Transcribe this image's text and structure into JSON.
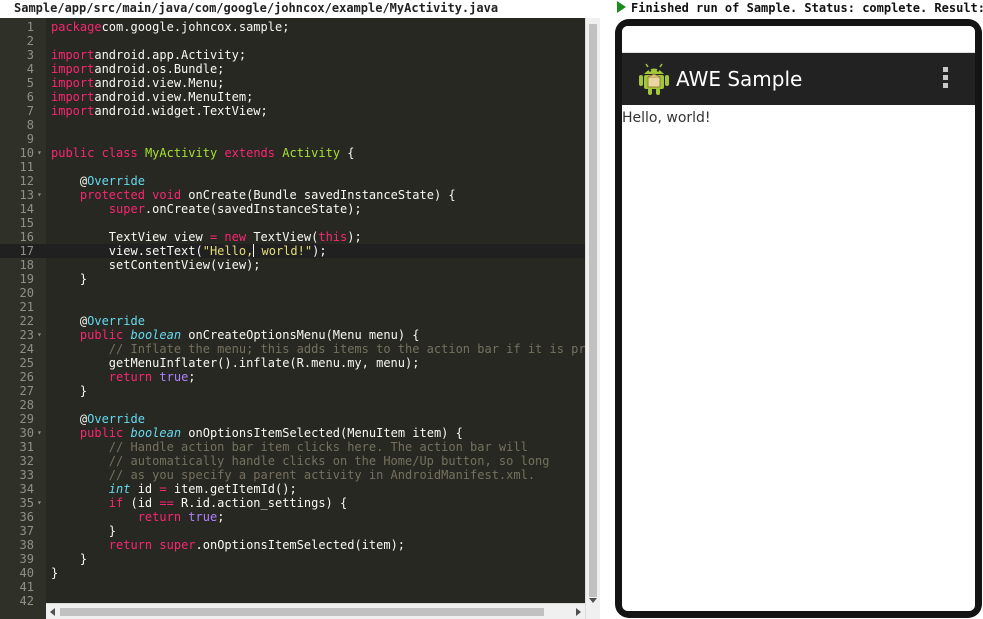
{
  "file_path": "Sample/app/src/main/java/com/google/johncox/example/MyActivity.java",
  "run_status": "Finished run of Sample. Status: complete. Result:",
  "editor": {
    "active_line": 17,
    "foldable_lines": [
      10,
      13,
      23,
      30,
      35
    ],
    "lines": [
      [
        [
          "kw",
          "package"
        ],
        [
          "",
          "com.google.johncox.sample;"
        ]
      ],
      [],
      [
        [
          "kw",
          "import"
        ],
        [
          "",
          "android.app.Activity;"
        ]
      ],
      [
        [
          "kw",
          "import"
        ],
        [
          "",
          "android.os.Bundle;"
        ]
      ],
      [
        [
          "kw",
          "import"
        ],
        [
          "",
          "android.view.Menu;"
        ]
      ],
      [
        [
          "kw",
          "import"
        ],
        [
          "",
          "android.view.MenuItem;"
        ]
      ],
      [
        [
          "kw",
          "import"
        ],
        [
          "",
          "android.widget.TextView;"
        ]
      ],
      [],
      [],
      [
        [
          "kw",
          "public"
        ],
        [
          "",
          ""
        ],
        [
          "kw",
          "class"
        ],
        [
          "",
          ""
        ],
        [
          "cl",
          "MyActivity"
        ],
        [
          "",
          ""
        ],
        [
          "kw",
          "extends"
        ],
        [
          "",
          ""
        ],
        [
          "cl",
          "Activity"
        ],
        [
          "",
          " {"
        ]
      ],
      [],
      [
        [
          "",
          "    @"
        ],
        [
          "an",
          "Override"
        ]
      ],
      [
        [
          "",
          "    "
        ],
        [
          "kw",
          "protected"
        ],
        [
          "",
          ""
        ],
        [
          "kw",
          "void"
        ],
        [
          "",
          " onCreate(Bundle savedInstanceState) {"
        ]
      ],
      [
        [
          "",
          "        "
        ],
        [
          "kw",
          "super"
        ],
        [
          "",
          ".onCreate(savedInstanceState);"
        ]
      ],
      [],
      [
        [
          "",
          "        TextView view "
        ],
        [
          "kw",
          "="
        ],
        [
          "",
          ""
        ],
        [
          "kw",
          "new"
        ],
        [
          "",
          " TextView("
        ],
        [
          "kw",
          "this"
        ],
        [
          "",
          ");"
        ]
      ],
      [
        [
          "",
          "        view.setText("
        ],
        [
          "str",
          "\"Hello,"
        ],
        [
          "caret",
          ""
        ],
        [
          "str",
          " world!\""
        ],
        [
          "",
          ");"
        ]
      ],
      [
        [
          "",
          "        setContentView(view);"
        ]
      ],
      [
        [
          "",
          "    }"
        ]
      ],
      [],
      [],
      [
        [
          "",
          "    @"
        ],
        [
          "an",
          "Override"
        ]
      ],
      [
        [
          "",
          "    "
        ],
        [
          "kw",
          "public"
        ],
        [
          "",
          ""
        ],
        [
          "st",
          "boolean"
        ],
        [
          "",
          " onCreateOptionsMenu(Menu menu) {"
        ]
      ],
      [
        [
          "",
          "        "
        ],
        [
          "cm",
          "// Inflate the menu; this adds items to the action bar if it is present."
        ]
      ],
      [
        [
          "",
          "        getMenuInflater().inflate(R.menu.my, menu);"
        ]
      ],
      [
        [
          "",
          "        "
        ],
        [
          "kw",
          "return"
        ],
        [
          "",
          ""
        ],
        [
          "lit",
          "true"
        ],
        [
          "",
          ";"
        ]
      ],
      [
        [
          "",
          "    }"
        ]
      ],
      [],
      [
        [
          "",
          "    @"
        ],
        [
          "an",
          "Override"
        ]
      ],
      [
        [
          "",
          "    "
        ],
        [
          "kw",
          "public"
        ],
        [
          "",
          ""
        ],
        [
          "st",
          "boolean"
        ],
        [
          "",
          " onOptionsItemSelected(MenuItem item) {"
        ]
      ],
      [
        [
          "",
          "        "
        ],
        [
          "cm",
          "// Handle action bar item clicks here. The action bar will"
        ]
      ],
      [
        [
          "",
          "        "
        ],
        [
          "cm",
          "// automatically handle clicks on the Home/Up button, so long"
        ]
      ],
      [
        [
          "",
          "        "
        ],
        [
          "cm",
          "// as you specify a parent activity in AndroidManifest.xml."
        ]
      ],
      [
        [
          "",
          "        "
        ],
        [
          "st",
          "int"
        ],
        [
          "",
          " id "
        ],
        [
          "kw",
          "="
        ],
        [
          "",
          " item.getItemId();"
        ]
      ],
      [
        [
          "",
          "        "
        ],
        [
          "kw",
          "if"
        ],
        [
          "",
          " (id "
        ],
        [
          "kw",
          "=="
        ],
        [
          "",
          " R.id.action_settings) {"
        ]
      ],
      [
        [
          "",
          "            "
        ],
        [
          "kw",
          "return"
        ],
        [
          "",
          ""
        ],
        [
          "lit",
          "true"
        ],
        [
          "",
          ";"
        ]
      ],
      [
        [
          "",
          "        }"
        ]
      ],
      [
        [
          "",
          "        "
        ],
        [
          "kw",
          "return"
        ],
        [
          "",
          ""
        ],
        [
          "kw",
          "super"
        ],
        [
          "",
          ".onOptionsItemSelected(item);"
        ]
      ],
      [
        [
          "",
          "    }"
        ]
      ],
      [
        [
          "",
          "}"
        ]
      ],
      [],
      []
    ]
  },
  "device": {
    "app_title": "AWE Sample",
    "app_icon": "android-robot-icon",
    "menu_icon": "overflow-menu-icon",
    "content_text": "Hello, world!",
    "action_bar_color": "#222222"
  },
  "colors": {
    "editor_bg": "#272822",
    "keyword": "#f92672",
    "type": "#66d9ef",
    "class_name": "#a6e22e",
    "string": "#e6db74",
    "comment": "#75715e",
    "literal": "#ae81ff",
    "run_icon": "#1a8c1a"
  }
}
